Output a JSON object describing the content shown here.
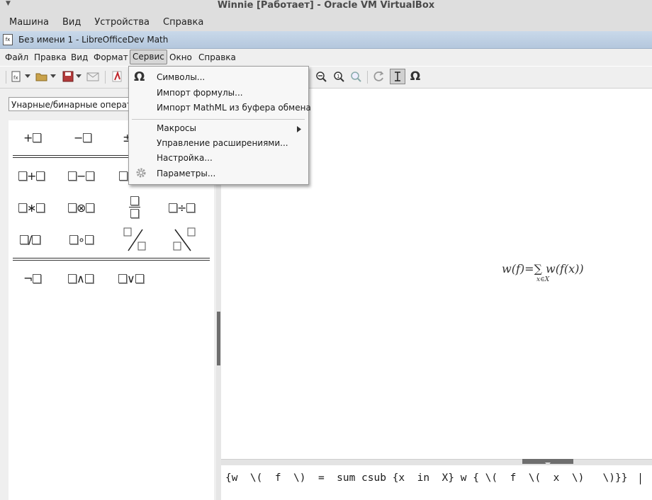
{
  "vbox": {
    "title": "Winnie [Работает] - Oracle VM VirtualBox",
    "menu": [
      "Машина",
      "Вид",
      "Устройства",
      "Справка"
    ]
  },
  "lo": {
    "title": "Без имени 1 - LibreOfficeDev Math",
    "menu": [
      "Файл",
      "Правка",
      "Вид",
      "Формат",
      "Сервис",
      "Окно",
      "Справка"
    ]
  },
  "tools_menu": {
    "items": [
      {
        "label": "Символы...",
        "icon": "omega-icon"
      },
      {
        "label": "Импорт формулы..."
      },
      {
        "label": "Импорт MathML из буфера обмена"
      },
      {
        "label": "Макросы",
        "submenu": true
      },
      {
        "label": "Управление расширениями..."
      },
      {
        "label": "Настройка..."
      },
      {
        "label": "Параметры...",
        "icon": "gear-icon"
      }
    ]
  },
  "elements": {
    "category": "Унарные/бинарные операторы"
  },
  "formula": {
    "main": "w(f)=∑ w(f(x))",
    "sub": "x∈X"
  },
  "editor": {
    "text": "{w  \\(  f  \\)  =  sum csub {x  in  X} w { \\(  f  \\(  x  \\)   \\)}}"
  }
}
